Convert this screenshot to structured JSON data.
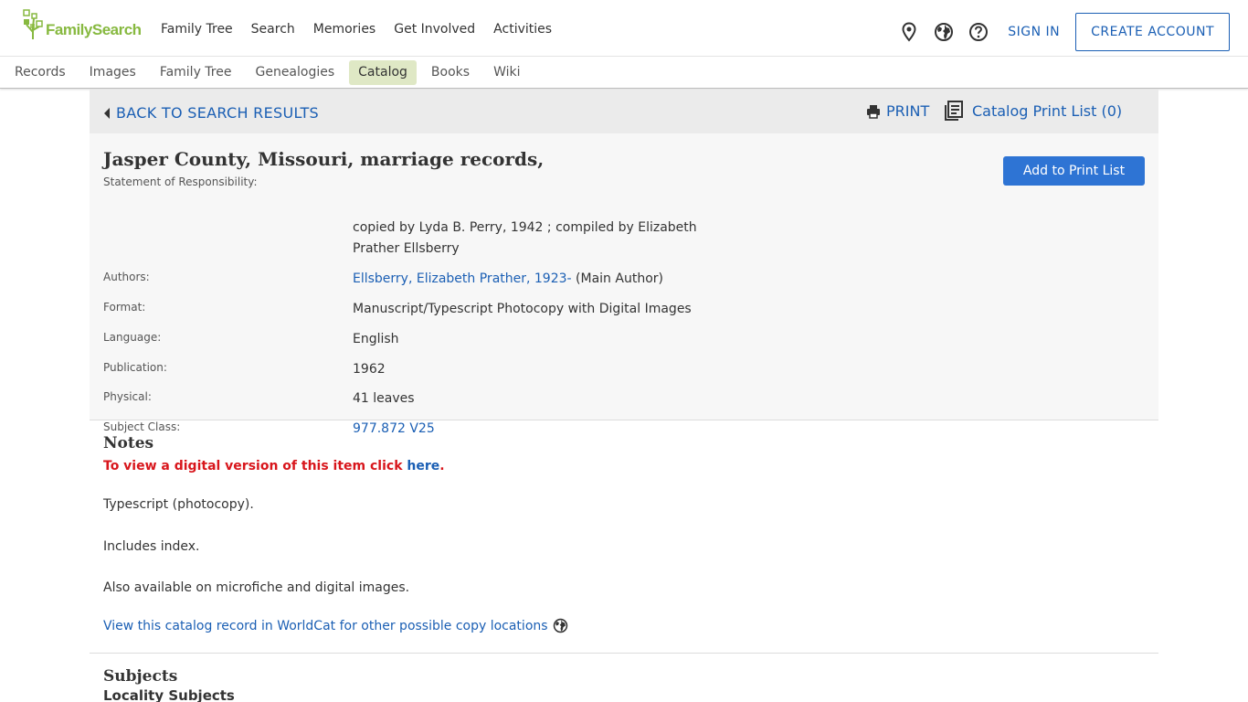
{
  "header": {
    "logo_text": "FamilySearch",
    "nav": [
      {
        "label": "Family Tree"
      },
      {
        "label": "Search"
      },
      {
        "label": "Memories"
      },
      {
        "label": "Get Involved"
      },
      {
        "label": "Activities"
      }
    ],
    "icons": [
      "location-pin-icon",
      "globe-icon",
      "help-icon"
    ],
    "sign_in": "SIGN IN",
    "create_account": "CREATE ACCOUNT"
  },
  "subnav": {
    "items": [
      {
        "label": "Records"
      },
      {
        "label": "Images"
      },
      {
        "label": "Family Tree"
      },
      {
        "label": "Genealogies"
      },
      {
        "label": "Catalog",
        "active": true
      },
      {
        "label": "Books"
      },
      {
        "label": "Wiki"
      }
    ]
  },
  "actionbar": {
    "back": "BACK TO SEARCH RESULTS",
    "print": "PRINT",
    "print_list": "Catalog Print List (0)"
  },
  "record": {
    "title": "Jasper County, Missouri, marriage records,",
    "add_button": "Add to Print List",
    "fields": {
      "responsibility": {
        "label": "Statement of Responsibility:",
        "value": "copied by Lyda B. Perry, 1942 ; compiled by Elizabeth Prather Ellsberry"
      },
      "authors": {
        "label": "Authors:",
        "link": "Ellsberry, Elizabeth Prather, 1923-",
        "suffix": " (Main Author)"
      },
      "format": {
        "label": "Format:",
        "value": "Manuscript/Typescript Photocopy with Digital Images"
      },
      "language": {
        "label": "Language:",
        "value": "English"
      },
      "publication": {
        "label": "Publication:",
        "value": "1962"
      },
      "physical": {
        "label": "Physical:",
        "value": "41 leaves"
      },
      "subject_class": {
        "label": "Subject Class:",
        "link": "977.872 V25"
      }
    }
  },
  "notes": {
    "title": "Notes",
    "digital_prefix": "To view a digital version of this item click ",
    "digital_link": "here",
    "digital_suffix": ".",
    "lines": [
      "Typescript (photocopy).",
      "Includes index.",
      "Also available on microfiche and digital images."
    ],
    "worldcat": "View this catalog record in WorldCat for other possible copy locations"
  },
  "subjects": {
    "title": "Subjects",
    "locality_title": "Locality Subjects"
  },
  "colors": {
    "link": "#1b5fb4",
    "brand_green": "#87b940",
    "primary_button": "#2e74d4",
    "alert_red": "#d8161c",
    "active_tab": "#dfe8c5"
  }
}
